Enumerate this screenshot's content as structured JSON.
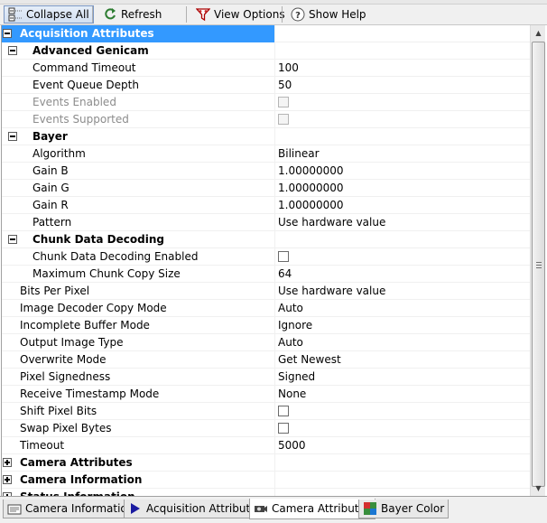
{
  "toolbar": {
    "collapse_all": "Collapse All",
    "refresh": "Refresh",
    "view_options": "View Options",
    "show_help": "Show Help"
  },
  "grid": {
    "rows": [
      {
        "name": "Acquisition Attributes",
        "value": "",
        "type": "category",
        "level": 0,
        "expanded": true,
        "selected": true
      },
      {
        "name": "Advanced Genicam",
        "value": "",
        "type": "category",
        "level": 1,
        "expanded": true
      },
      {
        "name": "Command Timeout",
        "value": "100",
        "level": 2
      },
      {
        "name": "Event Queue Depth",
        "value": "50",
        "level": 2
      },
      {
        "name": "Events Enabled",
        "value": "",
        "level": 2,
        "checkbox": true,
        "disabled": true
      },
      {
        "name": "Events Supported",
        "value": "",
        "level": 2,
        "checkbox": true,
        "disabled": true
      },
      {
        "name": "Bayer",
        "value": "",
        "type": "category",
        "level": 1,
        "expanded": true
      },
      {
        "name": "Algorithm",
        "value": "Bilinear",
        "level": 2
      },
      {
        "name": "Gain B",
        "value": "1.00000000",
        "level": 2
      },
      {
        "name": "Gain G",
        "value": "1.00000000",
        "level": 2
      },
      {
        "name": "Gain R",
        "value": "1.00000000",
        "level": 2
      },
      {
        "name": "Pattern",
        "value": "Use hardware value",
        "level": 2
      },
      {
        "name": "Chunk Data Decoding",
        "value": "",
        "type": "category",
        "level": 1,
        "expanded": true
      },
      {
        "name": "Chunk Data Decoding Enabled",
        "value": "",
        "level": 2,
        "checkbox": true
      },
      {
        "name": "Maximum Chunk Copy Size",
        "value": "64",
        "level": 2
      },
      {
        "name": "Bits Per Pixel",
        "value": "Use hardware value",
        "level": 1
      },
      {
        "name": "Image Decoder Copy Mode",
        "value": "Auto",
        "level": 1
      },
      {
        "name": "Incomplete Buffer Mode",
        "value": "Ignore",
        "level": 1
      },
      {
        "name": "Output Image Type",
        "value": "Auto",
        "level": 1
      },
      {
        "name": "Overwrite Mode",
        "value": "Get Newest",
        "level": 1
      },
      {
        "name": "Pixel Signedness",
        "value": "Signed",
        "level": 1
      },
      {
        "name": "Receive Timestamp Mode",
        "value": "None",
        "level": 1
      },
      {
        "name": "Shift Pixel Bits",
        "value": "",
        "level": 1,
        "checkbox": true
      },
      {
        "name": "Swap Pixel Bytes",
        "value": "",
        "level": 1,
        "checkbox": true
      },
      {
        "name": "Timeout",
        "value": "5000",
        "level": 1
      },
      {
        "name": "Camera Attributes",
        "value": "",
        "type": "category",
        "level": 0,
        "expanded": false
      },
      {
        "name": "Camera Information",
        "value": "",
        "type": "category",
        "level": 0,
        "expanded": false
      },
      {
        "name": "Status Information",
        "value": "",
        "type": "category",
        "level": 0,
        "expanded": false
      }
    ]
  },
  "tabs": [
    {
      "label": "Camera Information",
      "icon": "camera-info-icon",
      "active": false
    },
    {
      "label": "Acquisition Attributes",
      "icon": "play-arrow-icon",
      "active": false
    },
    {
      "label": "Camera Attributes",
      "icon": "camera-icon",
      "active": true
    },
    {
      "label": "Bayer Color",
      "icon": "bayer-color-icon",
      "active": false
    }
  ],
  "colors": {
    "selection": "#3399ff",
    "play_arrow": "#1a1aa0"
  }
}
